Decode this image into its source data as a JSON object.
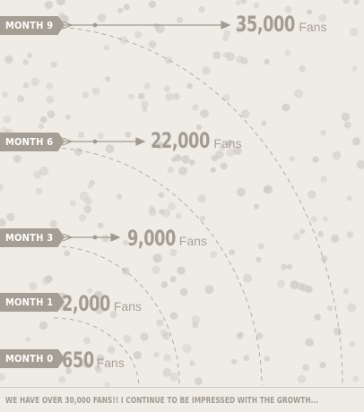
{
  "milestones": [
    {
      "label": "MONTH 9",
      "value": "35,000",
      "unit": "Fans"
    },
    {
      "label": "MONTH 6",
      "value": "22,000",
      "unit": "Fans"
    },
    {
      "label": "MONTH 3",
      "value": "9,000",
      "unit": "Fans"
    },
    {
      "label": "MONTH 1",
      "value": "2,000",
      "unit": "Fans"
    },
    {
      "label": "MONTH 0",
      "value": "650",
      "unit": "Fans"
    }
  ],
  "footer": {
    "text": "WE HAVE OVER 30,000 FANS!! I CONTINUE TO BE IMPRESSED WITH THE GROWTH..."
  },
  "colors": {
    "background": "#efece6",
    "tag": "#a59e94",
    "dots": "#cfcbc4",
    "arrows": "#a19a90"
  }
}
